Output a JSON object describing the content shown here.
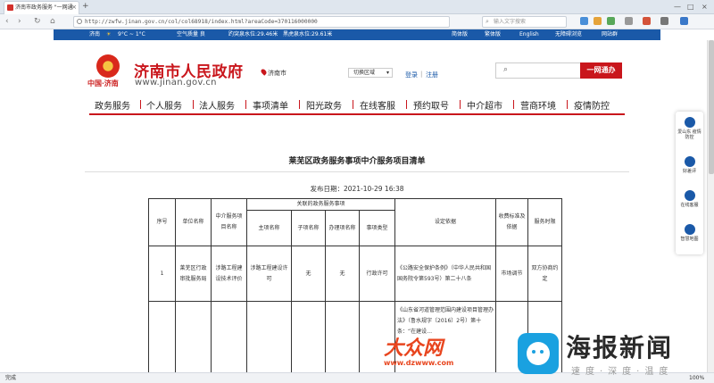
{
  "browser": {
    "tab_title": "济南市政务服务 \"一网通",
    "tab_close": "×",
    "new_tab": "+",
    "url": "http://zwfw.jinan.gov.cn/col/col68918/index.html?areaCode=370116000000",
    "search_placeholder": "输入文字搜索",
    "search_icon": "magnifier",
    "win_min": "—",
    "win_max": "□",
    "win_close": "×",
    "back": "‹",
    "forward": "›",
    "reload": "↻",
    "home": "⌂"
  },
  "infobar": {
    "city": "济南",
    "weather": "9°C ~ 1°C",
    "air_quality": "空气质量 良",
    "gauge1": "趵突泉水位:29.46米",
    "gauge2": "黑虎泉水位:29.61米",
    "links": [
      "简体版",
      "繁体版",
      "English",
      "无障碍浏览",
      "网站群"
    ]
  },
  "header": {
    "site_name": "济南市人民政府",
    "site_url": "www.jinan.gov.cn",
    "logo_sub": "中国·济南",
    "city": "济南市",
    "region_select": "切换区域",
    "login": "登录",
    "separator": "|",
    "register": "注册",
    "search_button": "一网通办"
  },
  "nav": {
    "items": [
      "政务服务",
      "个人服务",
      "法人服务",
      "事项清单",
      "阳光政务",
      "在线客服",
      "预约取号",
      "中介超市",
      "营商环境",
      "疫情防控"
    ]
  },
  "doc": {
    "title": "莱芜区政务服务事项中介服务项目清单",
    "publish_date": "发布日期：2021-10-29 16:38"
  },
  "table": {
    "headers": {
      "no": "序号",
      "unit": "单位名称",
      "service": "中介服务项目名称",
      "related": "关联的政务服务事项",
      "main_item": "主项名称",
      "sub_item": "子项名称",
      "handle_item": "办理项名称",
      "item_type": "事项类型",
      "basis": "设定依据",
      "fee_basis": "收费标准及依据",
      "time_limit": "服务时限"
    },
    "rows": [
      {
        "no": "1",
        "unit": "莱芜区行政审批服务局",
        "service": "涉路工程建设技术评价",
        "main_item": "涉路工程建设许可",
        "sub_item": "无",
        "handle_item": "无",
        "item_type": "行政许可",
        "basis": "《公路安全保护条例》（中华人民共和国国务院令第593号）第二十八条",
        "fee_basis": "市场调节",
        "time_limit": "双方协商约定"
      },
      {
        "no": "",
        "unit": "",
        "service": "",
        "main_item": "",
        "sub_item": "",
        "handle_item": "",
        "item_type": "",
        "basis": "《山东省河道管理范围内建设项目管理办法》（鲁水规字〔2016〕2号）第十条：“在建设…",
        "fee_basis": "",
        "time_limit": ""
      }
    ]
  },
  "float_panel": {
    "items": [
      "爱山东 疫情防控",
      "好差评",
      "在线客服",
      "智慧地图"
    ]
  },
  "status": {
    "text": "完成",
    "zoom": "100%"
  },
  "watermark": {
    "left_title": "大众网",
    "left_url": "www.dzwww.com",
    "right_title": "海报新闻",
    "right_slogan": "速度·深度·温度"
  }
}
